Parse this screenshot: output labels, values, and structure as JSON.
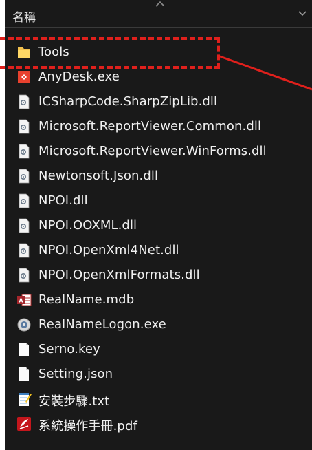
{
  "header": {
    "column_name": "名稱"
  },
  "colors": {
    "highlight": "#e0201c",
    "background": "#191919",
    "text": "#f0f0f0"
  },
  "files": [
    {
      "name": "Tools",
      "icon": "folder-icon"
    },
    {
      "name": "AnyDesk.exe",
      "icon": "anydesk-icon"
    },
    {
      "name": "ICSharpCode.SharpZipLib.dll",
      "icon": "dll-icon"
    },
    {
      "name": "Microsoft.ReportViewer.Common.dll",
      "icon": "dll-icon"
    },
    {
      "name": "Microsoft.ReportViewer.WinForms.dll",
      "icon": "dll-icon"
    },
    {
      "name": "Newtonsoft.Json.dll",
      "icon": "dll-icon"
    },
    {
      "name": "NPOI.dll",
      "icon": "dll-icon"
    },
    {
      "name": "NPOI.OOXML.dll",
      "icon": "dll-icon"
    },
    {
      "name": "NPOI.OpenXml4Net.dll",
      "icon": "dll-icon"
    },
    {
      "name": "NPOI.OpenXmlFormats.dll",
      "icon": "dll-icon"
    },
    {
      "name": "RealName.mdb",
      "icon": "access-db-icon"
    },
    {
      "name": "RealNameLogon.exe",
      "icon": "app-exe-icon"
    },
    {
      "name": "Serno.key",
      "icon": "blank-file-icon"
    },
    {
      "name": "Setting.json",
      "icon": "blank-file-icon"
    },
    {
      "name": "安裝步驟.txt",
      "icon": "notepad-icon"
    },
    {
      "name": "系統操作手冊.pdf",
      "icon": "pdf-icon"
    }
  ]
}
